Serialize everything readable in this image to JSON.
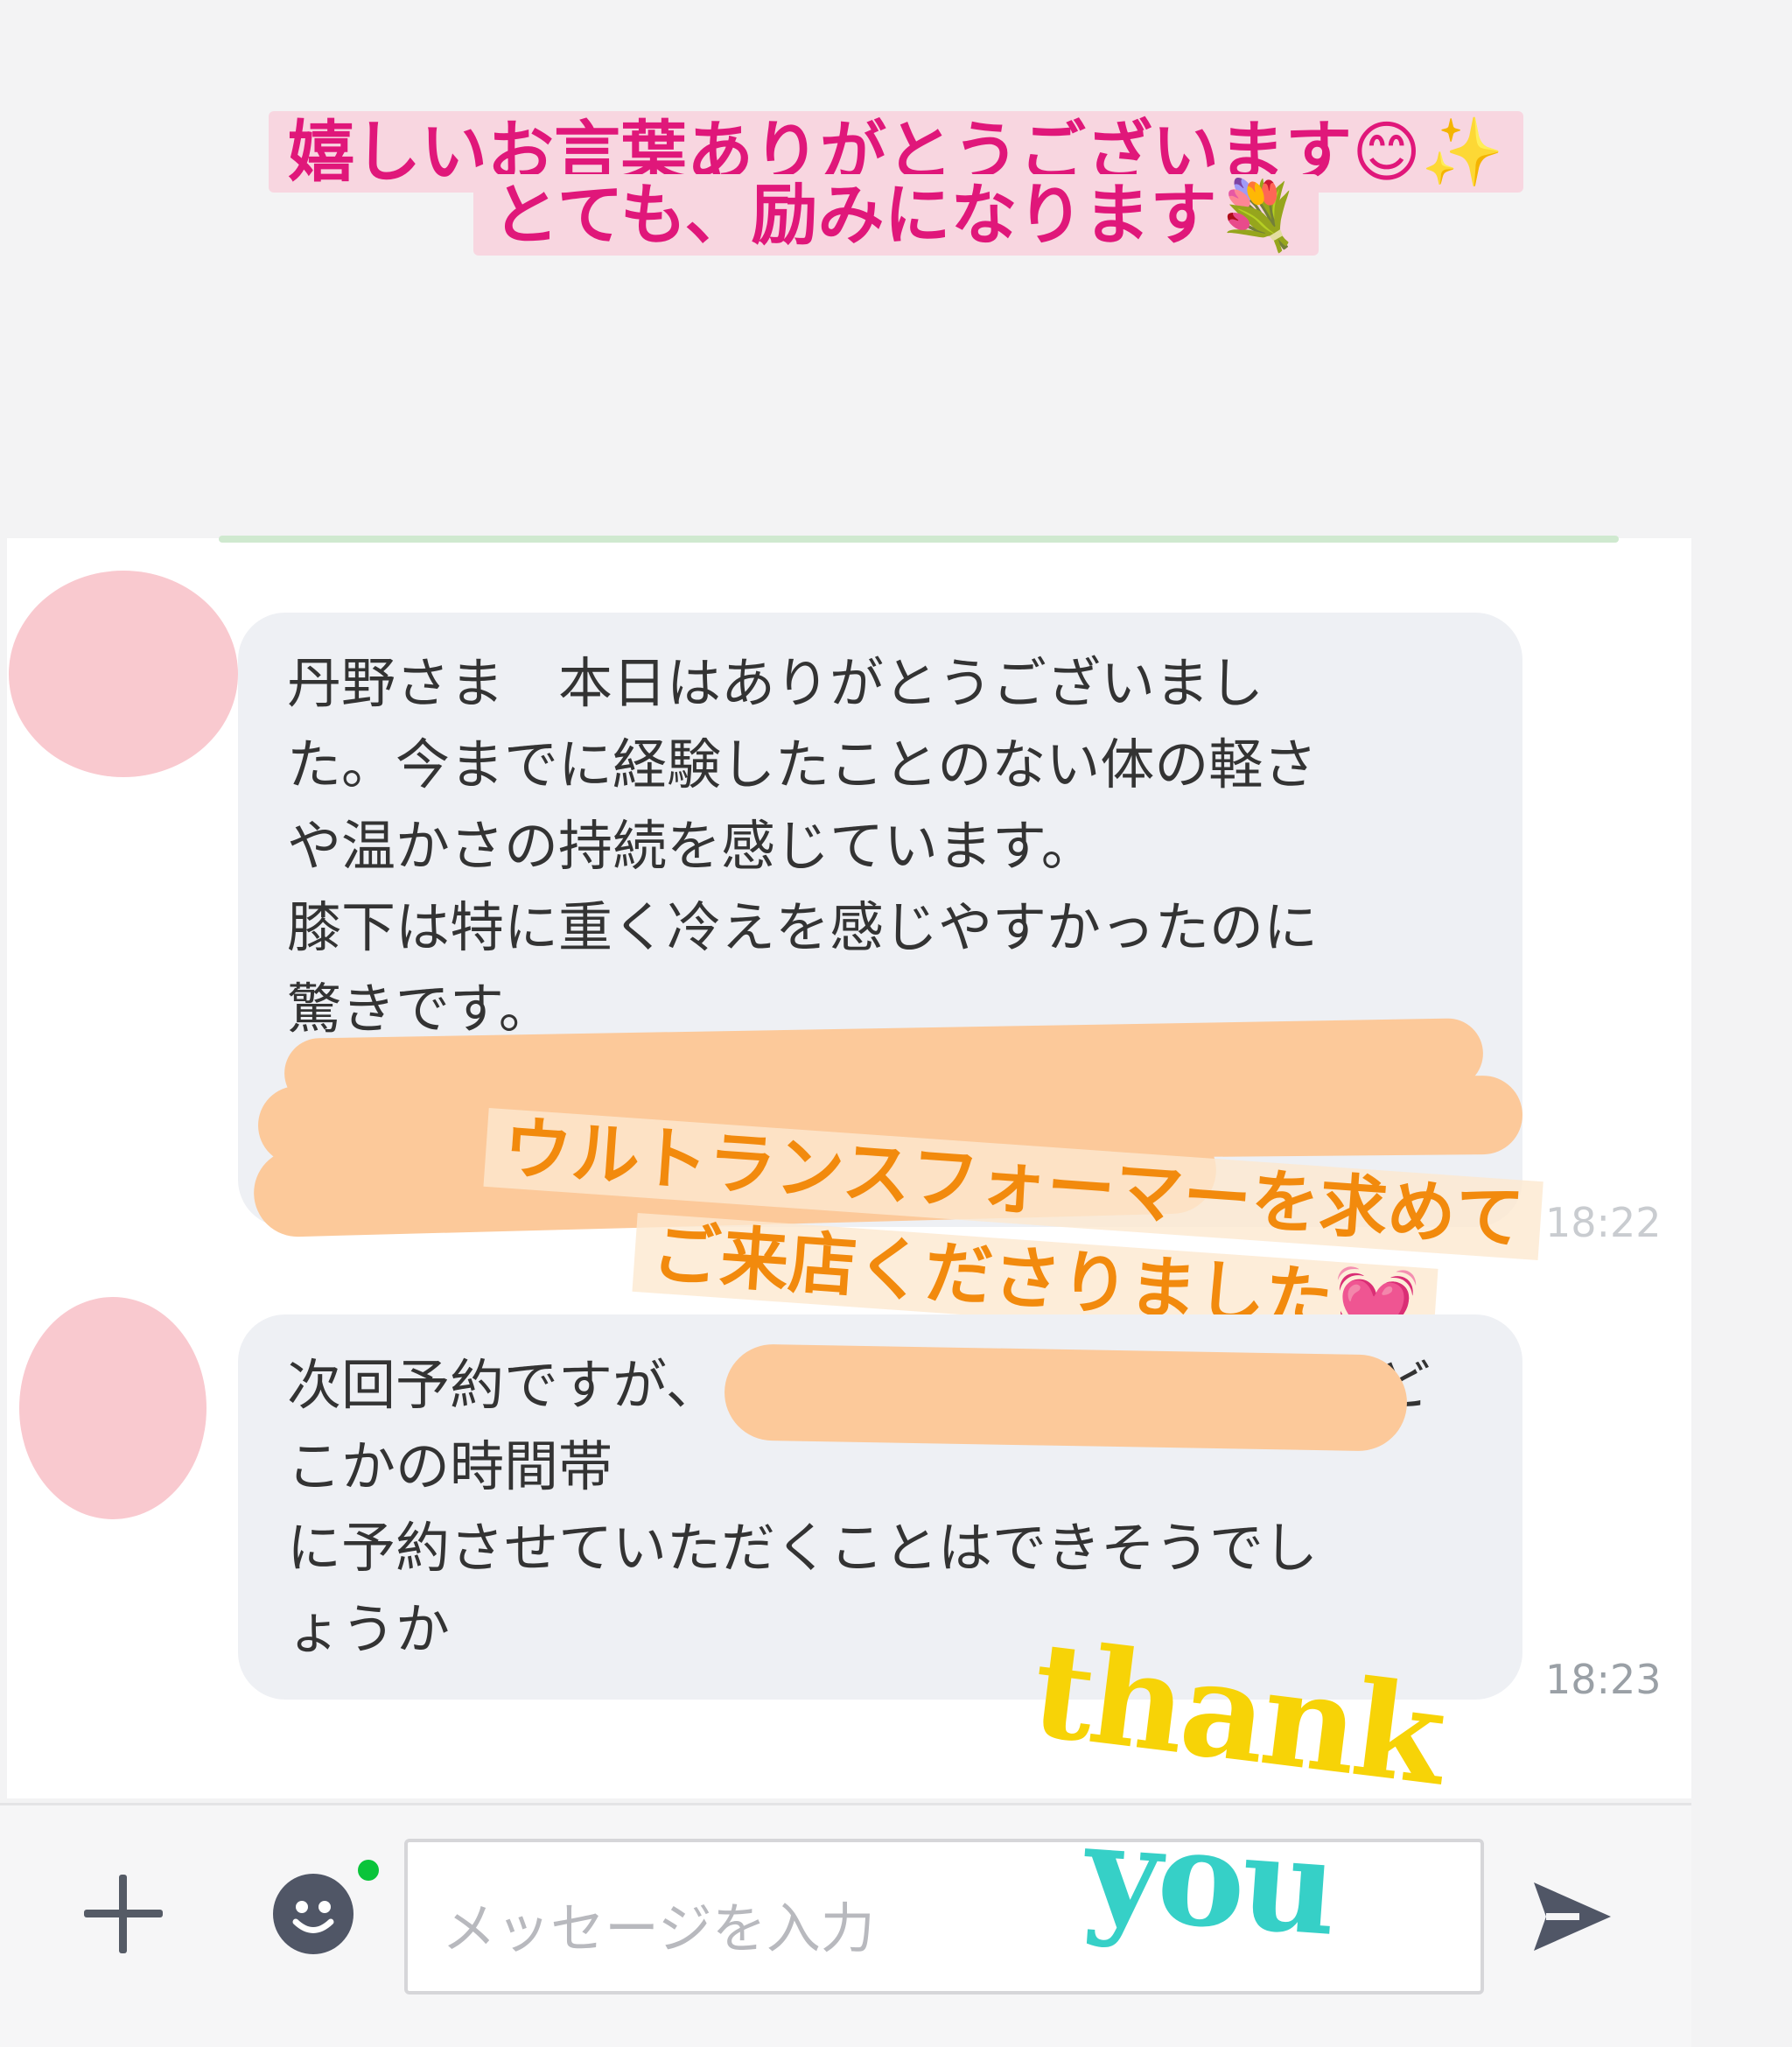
{
  "overlay_caption": {
    "line1": "嬉しいお言葉ありがとうございます😊✨",
    "line2": "とても、励みになります💐"
  },
  "messages": [
    {
      "lines": [
        "丹野さま　本日はありがとうございまし",
        "た。今までに経験したことのない体の軽さ",
        "や温かさの持続を感じています。",
        "膝下は特に重く冷えを感じやすかったのに",
        "驚きです。"
      ],
      "time": "18:22"
    },
    {
      "lines": [
        "次回予約ですが、",
        "こかの時間帯",
        "に予約させていただくことはできそうでし",
        "ょうか"
      ],
      "trailing_char": "ど",
      "time": "18:23"
    }
  ],
  "orange_caption": {
    "line1": "ウルトランスフォーマーを求めて",
    "line2": "ご来店くださりました💓"
  },
  "input": {
    "placeholder": "メッセージを入力"
  },
  "sticker": {
    "word1": "thank",
    "word2": "you"
  },
  "icons": {
    "plus": "plus-icon",
    "emoji": "smiley-icon",
    "send": "send-icon"
  }
}
